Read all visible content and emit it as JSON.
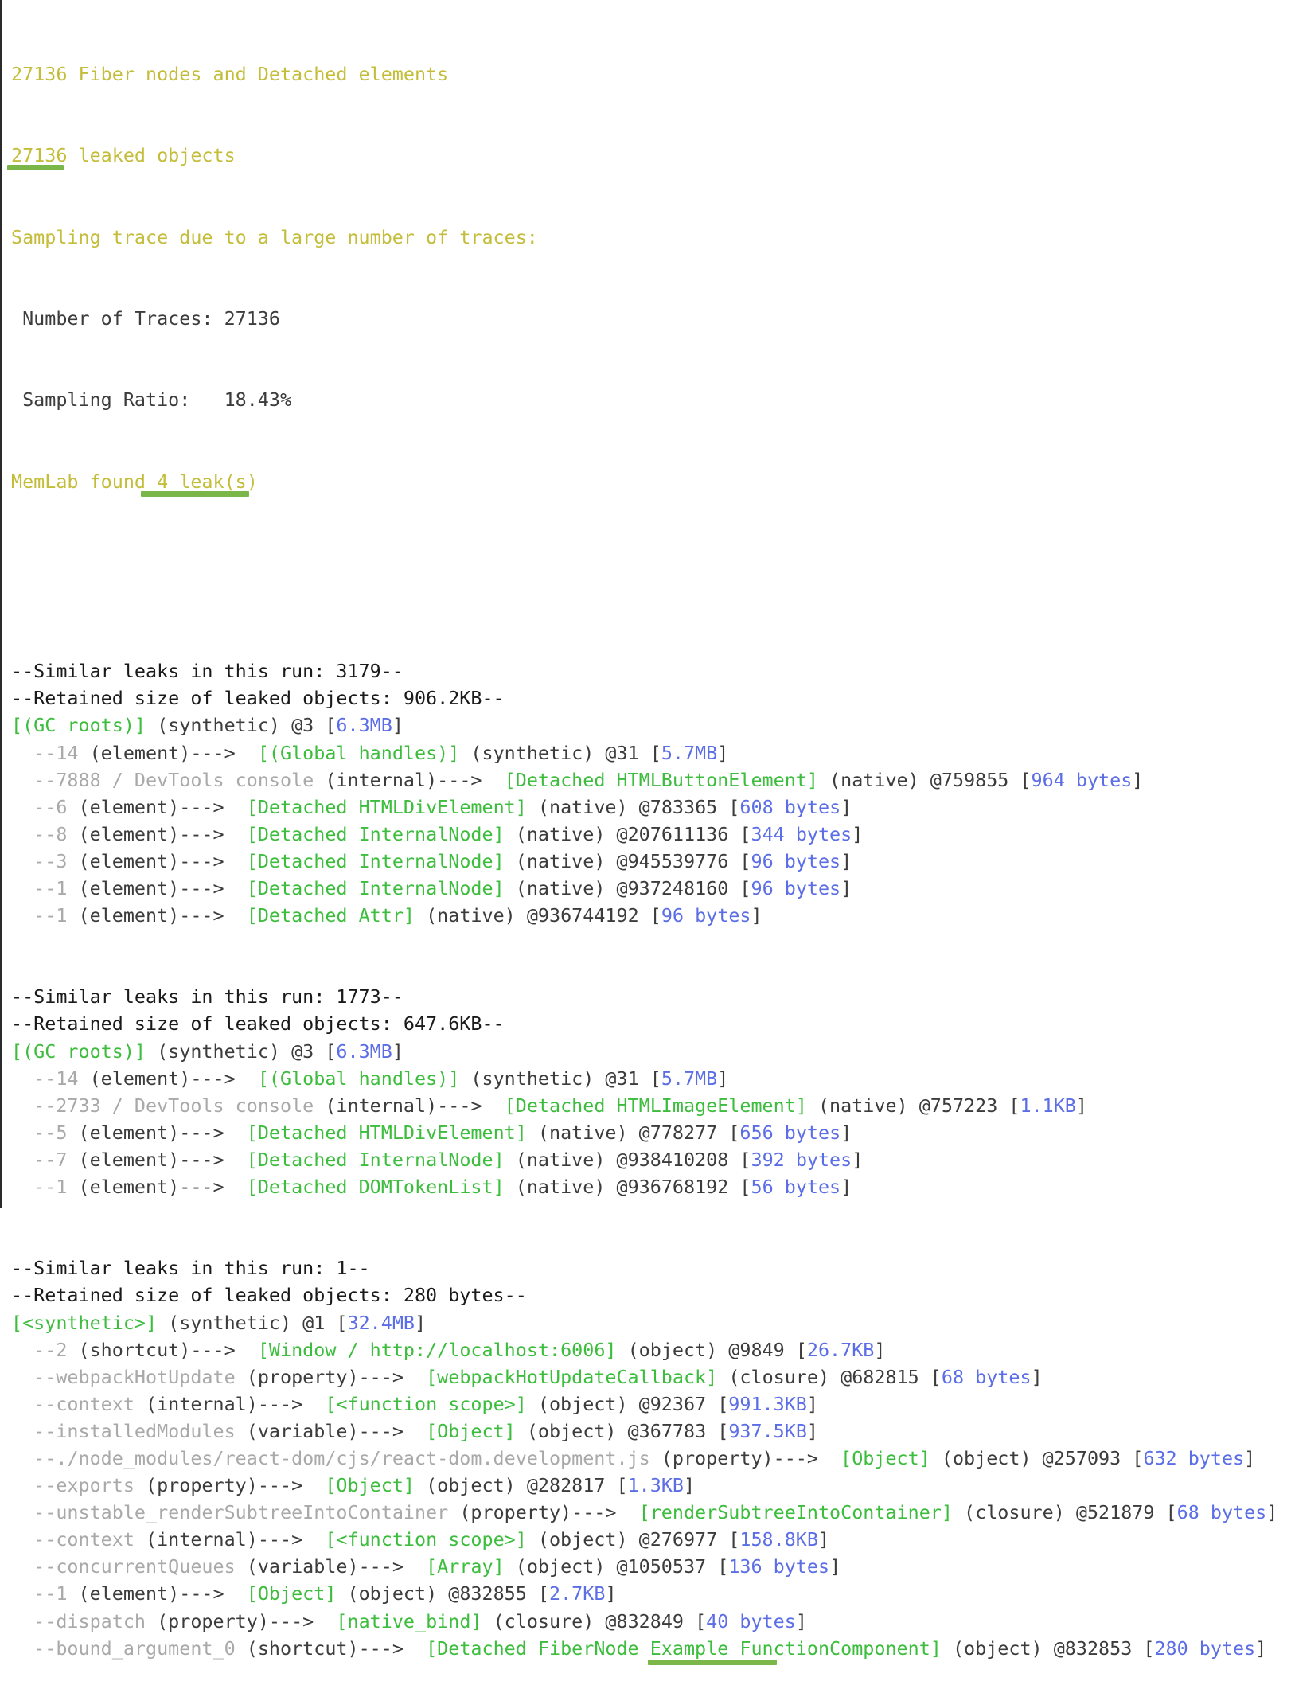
{
  "header": {
    "fiber_line": "27136 Fiber nodes and Detached elements",
    "leaked_count": "27136",
    "leaked_label": " leaked objects",
    "sampling_note": "Sampling trace due to a large number of traces:",
    "traces_line": " Number of Traces: 27136",
    "ratio_line": " Sampling Ratio:   18.43%",
    "found_prefix": "MemLab found ",
    "found_count": "4 leak(s)"
  },
  "colors": {
    "yellow": "#c3bd3a",
    "gray": "#a9a9a9",
    "dark": "#3c3c3c",
    "green": "#3dbd3d",
    "blue": "#5c6ee6",
    "highlight": "#7ab648"
  },
  "leaks": [
    {
      "similar": "--Similar leaks in this run: 3179--",
      "retained": "--Retained size of leaked objects: 906.2KB--",
      "root": {
        "node": "[(GC roots)]",
        "kind": " (synthetic) @3 [",
        "size": "6.3MB",
        "close": "]"
      },
      "edges": [
        {
          "prefix": "  --",
          "edge": "14",
          "type": " (element)--->  ",
          "node": "[(Global handles)]",
          "kind": " (synthetic) @31 [",
          "size": "5.7MB",
          "close": "]"
        },
        {
          "prefix": "  --",
          "edge": "7888 / DevTools console",
          "type": " (internal)--->  ",
          "node": "[Detached HTMLButtonElement]",
          "kind": " (native) @759855 [",
          "size": "964 bytes",
          "close": "]"
        },
        {
          "prefix": "  --",
          "edge": "6",
          "type": " (element)--->  ",
          "node": "[Detached HTMLDivElement]",
          "kind": " (native) @783365 [",
          "size": "608 bytes",
          "close": "]"
        },
        {
          "prefix": "  --",
          "edge": "8",
          "type": " (element)--->  ",
          "node": "[Detached InternalNode]",
          "kind": " (native) @207611136 [",
          "size": "344 bytes",
          "close": "]"
        },
        {
          "prefix": "  --",
          "edge": "3",
          "type": " (element)--->  ",
          "node": "[Detached InternalNode]",
          "kind": " (native) @945539776 [",
          "size": "96 bytes",
          "close": "]"
        },
        {
          "prefix": "  --",
          "edge": "1",
          "type": " (element)--->  ",
          "node": "[Detached InternalNode]",
          "kind": " (native) @937248160 [",
          "size": "96 bytes",
          "close": "]"
        },
        {
          "prefix": "  --",
          "edge": "1",
          "type": " (element)--->  ",
          "node": "[Detached Attr]",
          "kind": " (native) @936744192 [",
          "size": "96 bytes",
          "close": "]"
        }
      ]
    },
    {
      "similar": "--Similar leaks in this run: 1773--",
      "retained": "--Retained size of leaked objects: 647.6KB--",
      "root": {
        "node": "[(GC roots)]",
        "kind": " (synthetic) @3 [",
        "size": "6.3MB",
        "close": "]"
      },
      "edges": [
        {
          "prefix": "  --",
          "edge": "14",
          "type": " (element)--->  ",
          "node": "[(Global handles)]",
          "kind": " (synthetic) @31 [",
          "size": "5.7MB",
          "close": "]"
        },
        {
          "prefix": "  --",
          "edge": "2733 / DevTools console",
          "type": " (internal)--->  ",
          "node": "[Detached HTMLImageElement]",
          "kind": " (native) @757223 [",
          "size": "1.1KB",
          "close": "]"
        },
        {
          "prefix": "  --",
          "edge": "5",
          "type": " (element)--->  ",
          "node": "[Detached HTMLDivElement]",
          "kind": " (native) @778277 [",
          "size": "656 bytes",
          "close": "]"
        },
        {
          "prefix": "  --",
          "edge": "7",
          "type": " (element)--->  ",
          "node": "[Detached InternalNode]",
          "kind": " (native) @938410208 [",
          "size": "392 bytes",
          "close": "]"
        },
        {
          "prefix": "  --",
          "edge": "1",
          "type": " (element)--->  ",
          "node": "[Detached DOMTokenList]",
          "kind": " (native) @936768192 [",
          "size": "56 bytes",
          "close": "]"
        }
      ]
    },
    {
      "similar": "--Similar leaks in this run: 1--",
      "retained": "--Retained size of leaked objects: 280 bytes--",
      "root": {
        "node": "[<synthetic>]",
        "kind": " (synthetic) @1 [",
        "size": "32.4MB",
        "close": "]"
      },
      "edges": [
        {
          "prefix": "  --",
          "edge": "2",
          "type": " (shortcut)--->  ",
          "node": "[Window / http://localhost:6006]",
          "kind": " (object) @9849 [",
          "size": "26.7KB",
          "close": "]"
        },
        {
          "prefix": "  --",
          "edge": "webpackHotUpdate",
          "type": " (property)--->  ",
          "node": "[webpackHotUpdateCallback]",
          "kind": " (closure) @682815 [",
          "size": "68 bytes",
          "close": "]"
        },
        {
          "prefix": "  --",
          "edge": "context",
          "type": " (internal)--->  ",
          "node": "[<function scope>]",
          "kind": " (object) @92367 [",
          "size": "991.3KB",
          "close": "]"
        },
        {
          "prefix": "  --",
          "edge": "installedModules",
          "type": " (variable)--->  ",
          "node": "[Object]",
          "kind": " (object) @367783 [",
          "size": "937.5KB",
          "close": "]"
        },
        {
          "prefix": "  --",
          "edge": "./node_modules/react-dom/cjs/react-dom.development.js",
          "type": " (property)--->  ",
          "node": "[Object]",
          "kind": " (object) @257093 [",
          "size": "632 bytes",
          "close": "]"
        },
        {
          "prefix": "  --",
          "edge": "exports",
          "type": " (property)--->  ",
          "node": "[Object]",
          "kind": " (object) @282817 [",
          "size": "1.3KB",
          "close": "]"
        },
        {
          "prefix": "  --",
          "edge": "unstable_renderSubtreeIntoContainer",
          "type": " (property)--->  ",
          "node": "[renderSubtreeIntoContainer]",
          "kind": " (closure) @521879 [",
          "size": "68 bytes",
          "close": "]"
        },
        {
          "prefix": "  --",
          "edge": "context",
          "type": " (internal)--->  ",
          "node": "[<function scope>]",
          "kind": " (object) @276977 [",
          "size": "158.8KB",
          "close": "]"
        },
        {
          "prefix": "  --",
          "edge": "concurrentQueues",
          "type": " (variable)--->  ",
          "node": "[Array]",
          "kind": " (object) @1050537 [",
          "size": "136 bytes",
          "close": "]"
        },
        {
          "prefix": "  --",
          "edge": "1",
          "type": " (element)--->  ",
          "node": "[Object]",
          "kind": " (object) @832855 [",
          "size": "2.7KB",
          "close": "]"
        },
        {
          "prefix": "  --",
          "edge": "dispatch",
          "type": " (property)--->  ",
          "node": "[native_bind]",
          "kind": " (closure) @832849 [",
          "size": "40 bytes",
          "close": "]"
        },
        {
          "prefix": "  --",
          "edge": "bound_argument_0",
          "type": " (shortcut)--->  ",
          "node": "[Detached FiberNode Example FunctionComponent]",
          "kind": " (object) @832853 [",
          "size": "280 bytes",
          "close": "]"
        }
      ]
    }
  ]
}
